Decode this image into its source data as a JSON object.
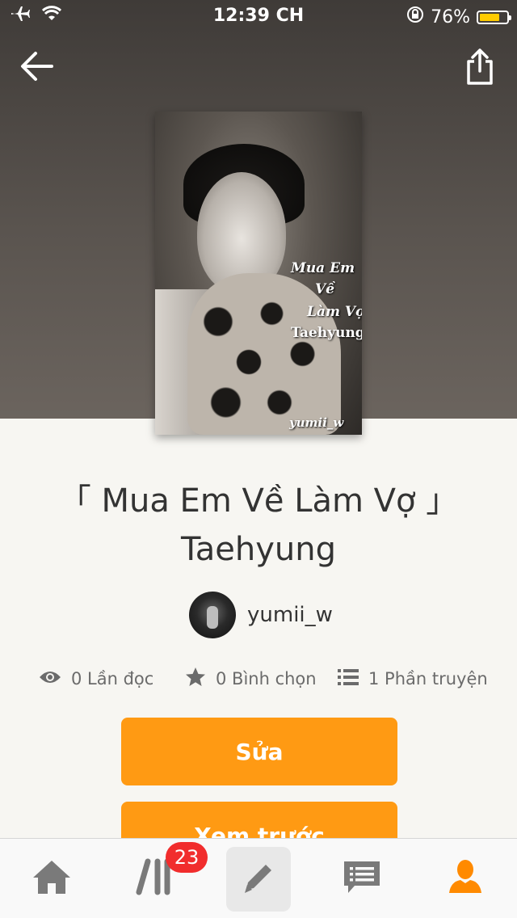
{
  "status_bar": {
    "time": "12:39 CH",
    "battery_percent": "76%",
    "battery_level": 0.76,
    "icons": [
      "airplane-icon",
      "wifi-icon",
      "rotation-lock-icon",
      "battery-icon"
    ]
  },
  "header": {
    "back_icon": "arrow-left-icon",
    "share_icon": "share-icon"
  },
  "cover": {
    "text_lines": [
      "Mua Em",
      "Về",
      "Làm Vợ",
      "Taehyung"
    ],
    "author_tag": "yumii_w"
  },
  "story": {
    "title_line1": "「 Mua Em Về Làm Vợ 」",
    "title_line2": "Taehyung",
    "author": "yumii_w"
  },
  "stats": {
    "reads": "0 Lần đọc",
    "votes": "0 Bình chọn",
    "parts": "1 Phần truyện"
  },
  "buttons": {
    "edit": "Sửa",
    "preview": "Xem trước"
  },
  "tabbar": {
    "items": [
      "home-icon",
      "library-icon",
      "write-icon",
      "messages-icon",
      "profile-icon"
    ],
    "library_badge": "23"
  },
  "colors": {
    "accent": "#ff9a13",
    "badge": "#f12d2d",
    "profile_active": "#ff8a00"
  }
}
